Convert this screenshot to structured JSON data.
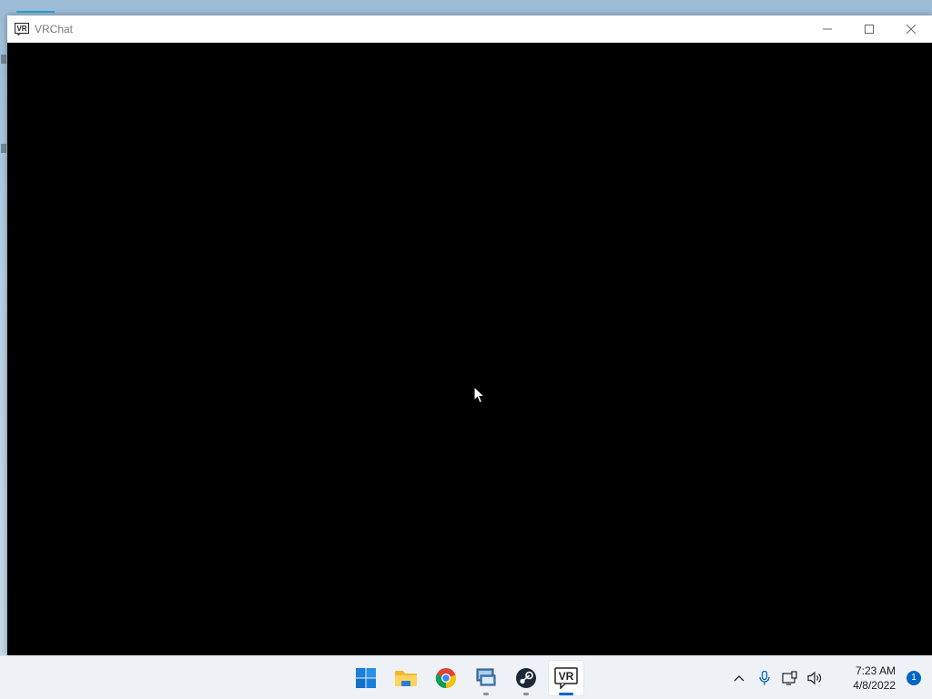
{
  "window": {
    "title": "VRChat",
    "app_icon_text": "VR",
    "controls": [
      "minimize-icon",
      "maximize-icon",
      "close-icon"
    ]
  },
  "taskbar": {
    "apps": [
      {
        "name": "start",
        "icon": "windows-logo-icon"
      },
      {
        "name": "file-explorer",
        "icon": "folder-icon"
      },
      {
        "name": "chrome",
        "icon": "chrome-icon"
      },
      {
        "name": "remote-desktop",
        "icon": "computer-icon"
      },
      {
        "name": "steam",
        "icon": "steam-icon"
      },
      {
        "name": "vrchat",
        "icon": "vrchat-icon",
        "icon_text": "VR",
        "active": true
      }
    ],
    "tray": {
      "icons": [
        "chevron-up-icon",
        "microphone-icon",
        "network-icon",
        "speaker-icon"
      ],
      "time": "7:23 AM",
      "date": "4/8/2022",
      "notification_count": "1"
    }
  },
  "colors": {
    "accent": "#0067c0",
    "taskbar_bg": "#eef1f5",
    "viewport_bg": "#000000"
  }
}
